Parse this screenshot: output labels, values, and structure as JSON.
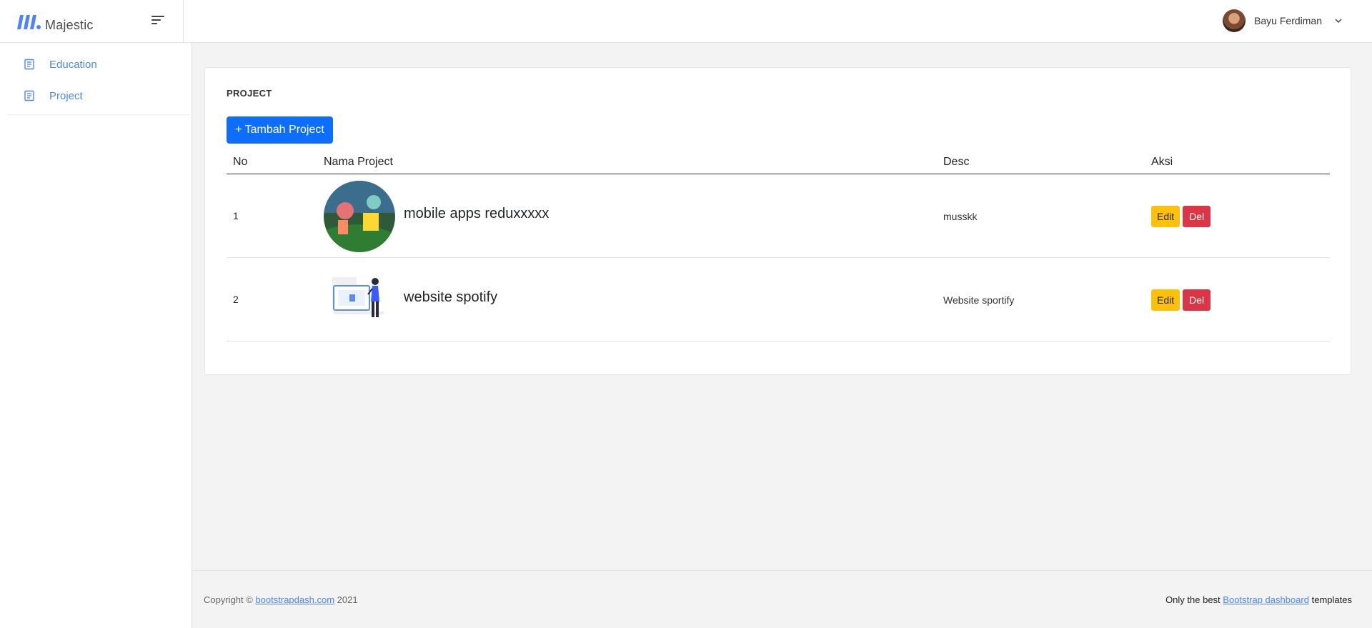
{
  "brand": {
    "name": "Majestic",
    "logo_icon": "majestic-logo-icon",
    "accent": "#4d83ff"
  },
  "header": {
    "menu_icon": "hamburger-menu-icon",
    "user_name": "Bayu Ferdiman",
    "dropdown_icon": "chevron-down-icon"
  },
  "sidebar": {
    "items": [
      {
        "label": "Education",
        "icon": "document-icon"
      },
      {
        "label": "Project",
        "icon": "document-icon"
      }
    ]
  },
  "main": {
    "title": "PROJECT",
    "add_button_label": "+ Tambah Project",
    "add_button_color": "#0d6efd",
    "columns": [
      "No",
      "Nama Project",
      "Desc",
      "Aksi"
    ],
    "rows": [
      {
        "no": "1",
        "name": "mobile apps reduxxxxx",
        "desc": "musskk",
        "edit_label": "Edit",
        "delete_label": "Del",
        "thumbnail": "cartoon-characters-thumbnail"
      },
      {
        "no": "2",
        "name": "website spotify",
        "desc": "Website sportify",
        "edit_label": "Edit",
        "delete_label": "Del",
        "thumbnail": "person-at-screen-illustration"
      }
    ],
    "edit_color": "#ffc107",
    "delete_color": "#dc3545"
  },
  "footer": {
    "copyright_prefix": "Copyright ©",
    "copyright_link": "bootstrapdash.com",
    "copyright_year": "2021",
    "tagline_prefix": "Only the best",
    "tagline_link": "Bootstrap dashboard",
    "tagline_suffix": "templates"
  }
}
